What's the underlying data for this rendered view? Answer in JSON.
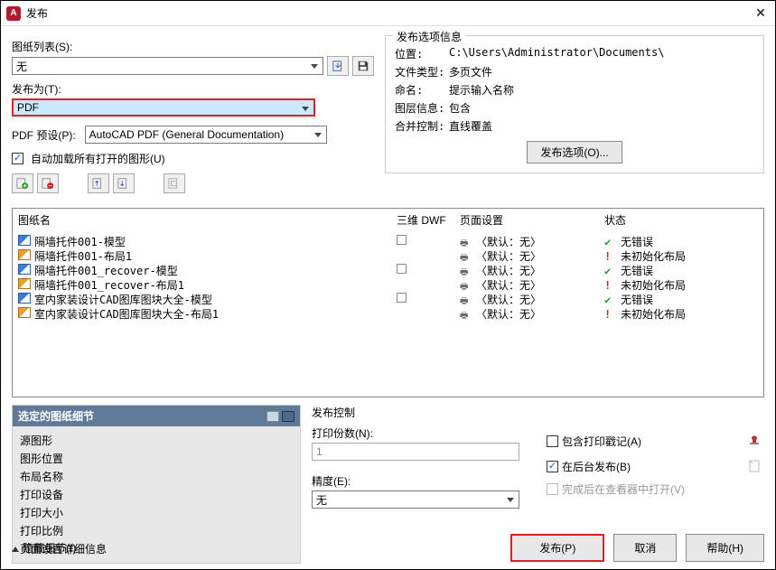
{
  "window": {
    "title": "发布",
    "app_letter": "A"
  },
  "sheetList": {
    "label": "图纸列表(S):",
    "value": "无",
    "publishAsLabel": "发布为(T):",
    "publishAsValue": "PDF",
    "presetLabel": "PDF 预设(P):",
    "presetValue": "AutoCAD PDF (General Documentation)",
    "autoLoadLabel": "自动加载所有打开的图形(U)"
  },
  "options": {
    "title": "发布选项信息",
    "rows": [
      {
        "label": "位置:",
        "value": "C:\\Users\\Administrator\\Documents\\"
      },
      {
        "label": "文件类型:",
        "value": "多页文件"
      },
      {
        "label": "命名:",
        "value": "提示输入名称"
      },
      {
        "label": "图层信息:",
        "value": "包含"
      },
      {
        "label": "合并控制:",
        "value": "直线覆盖"
      }
    ],
    "button": "发布选项(O)..."
  },
  "table": {
    "headers": {
      "name": "图纸名",
      "threeD": "三维 DWF",
      "page": "页面设置",
      "status": "状态"
    },
    "rows": [
      {
        "icon": "blue",
        "name": "隔墙托件001-模型",
        "ck": true,
        "page": "〈默认：无〉",
        "status": "无错误",
        "ok": true
      },
      {
        "icon": "orange",
        "name": "隔墙托件001-布局1",
        "ck": false,
        "page": "〈默认：无〉",
        "status": "未初始化布局",
        "ok": false
      },
      {
        "icon": "blue",
        "name": "隔墙托件001_recover-模型",
        "ck": true,
        "page": "〈默认：无〉",
        "status": "无错误",
        "ok": true
      },
      {
        "icon": "orange",
        "name": "隔墙托件001_recover-布局1",
        "ck": false,
        "page": "〈默认：无〉",
        "status": "未初始化布局",
        "ok": false
      },
      {
        "icon": "blue",
        "name": "室内家装设计CAD图库图块大全-模型",
        "ck": true,
        "page": "〈默认：无〉",
        "status": "无错误",
        "ok": true
      },
      {
        "icon": "orange",
        "name": "室内家装设计CAD图库图块大全-布局1",
        "ck": false,
        "page": "〈默认：无〉",
        "status": "未初始化布局",
        "ok": false
      }
    ]
  },
  "details": {
    "title": "选定的图纸细节",
    "items": [
      "源图形",
      "图形位置",
      "布局名称",
      "打印设备",
      "打印大小",
      "打印比例",
      "页面设置详细信息"
    ]
  },
  "publishCtrl": {
    "title": "发布控制",
    "copiesLabel": "打印份数(N):",
    "copiesValue": "1",
    "precisionLabel": "精度(E):",
    "precisionValue": "无",
    "includeStamp": "包含打印戳记(A)",
    "background": "在后台发布(B)",
    "openViewer": "完成后在查看器中打开(V)"
  },
  "footer": {
    "hideDetails": "隐藏细节(I)",
    "publish": "发布(P)",
    "cancel": "取消",
    "help": "帮助(H)"
  }
}
